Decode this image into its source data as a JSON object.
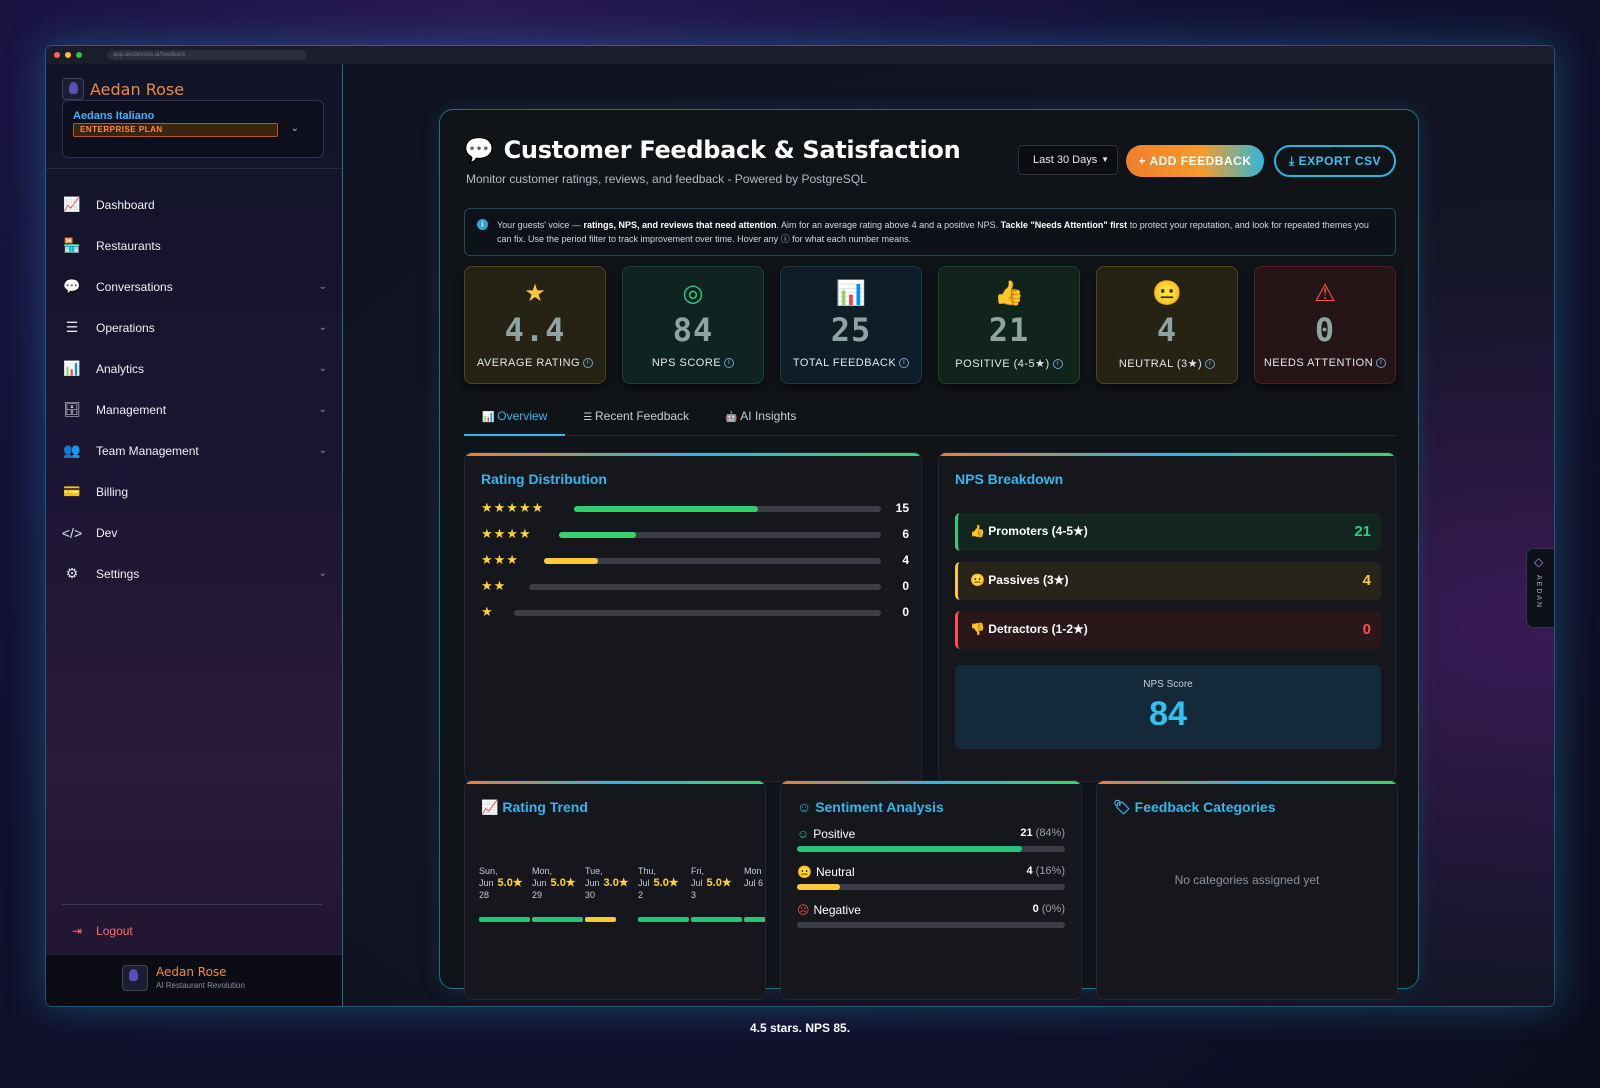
{
  "browser": {
    "url": "app.aedanrose.ai/feedback"
  },
  "sidebar": {
    "brand": "Aedan Rose",
    "org_name": "Aedans Italiano",
    "plan": "ENTERPRISE PLAN",
    "items": [
      {
        "label": "Dashboard",
        "icon": "chart-line-icon",
        "glyph": "📈",
        "chevron": false
      },
      {
        "label": "Restaurants",
        "icon": "store-icon",
        "glyph": "🏪",
        "chevron": false
      },
      {
        "label": "Conversations",
        "icon": "chat-bubbles-icon",
        "glyph": "💬",
        "chevron": true
      },
      {
        "label": "Operations",
        "icon": "task-list-icon",
        "glyph": "☰",
        "chevron": true
      },
      {
        "label": "Analytics",
        "icon": "bar-chart-icon",
        "glyph": "📊",
        "chevron": true
      },
      {
        "label": "Management",
        "icon": "database-icon",
        "glyph": "🗄",
        "chevron": true
      },
      {
        "label": "Team Management",
        "icon": "users-icon",
        "glyph": "👥",
        "chevron": true
      },
      {
        "label": "Billing",
        "icon": "credit-card-icon",
        "glyph": "💳",
        "chevron": false
      },
      {
        "label": "Dev",
        "icon": "code-icon",
        "glyph": "</>",
        "chevron": false
      },
      {
        "label": "Settings",
        "icon": "gear-icon",
        "glyph": "⚙",
        "chevron": true
      }
    ],
    "logout": "Logout",
    "footer_name": "Aedan Rose",
    "footer_sub": "AI Restaurant Revolution"
  },
  "header": {
    "title": "Customer Feedback & Satisfaction",
    "subtitle": "Monitor customer ratings, reviews, and feedback - Powered by PostgreSQL",
    "period": "Last 30 Days",
    "add_button": "+ ADD FEEDBACK",
    "export_button": "EXPORT CSV"
  },
  "info": {
    "part1": "Your guests' voice — ",
    "bold1": "ratings, NPS, and reviews that need attention",
    "part2": ". Aim for an average rating above 4 and a positive NPS. ",
    "bold2": "Tackle \"Needs Attention\" first",
    "part3": " to protect your reputation, and look for repeated themes you can fix. Use the period filter to track improvement over time. Hover any ⓘ for what each number means."
  },
  "stats": [
    {
      "value": "4.4",
      "label": "AVERAGE RATING",
      "icon": "star-icon",
      "glyph": "★",
      "color": "#ffc93a",
      "bg": "#262214"
    },
    {
      "value": "84",
      "label": "NPS SCORE",
      "icon": "target-icon",
      "glyph": "◎",
      "color": "#27d07c",
      "bg": "#0f2420"
    },
    {
      "value": "25",
      "label": "TOTAL FEEDBACK",
      "icon": "bar-chart-icon",
      "glyph": "📊",
      "color": "#2fb8ea",
      "bg": "#0f1e26"
    },
    {
      "value": "21",
      "label": "POSITIVE (4-5★)",
      "icon": "thumbs-up-icon",
      "glyph": "👍",
      "color": "#27d07c",
      "bg": "#10241c"
    },
    {
      "value": "4",
      "label": "NEUTRAL (3★)",
      "icon": "neutral-face-icon",
      "glyph": "😐",
      "color": "#ffc93a",
      "bg": "#262214"
    },
    {
      "value": "0",
      "label": "NEEDS ATTENTION",
      "icon": "warning-icon",
      "glyph": "⚠",
      "color": "#ff4d4d",
      "bg": "#261516"
    }
  ],
  "tabs": [
    {
      "label": "Overview",
      "icon": "chart-icon",
      "active": true
    },
    {
      "label": "Recent Feedback",
      "icon": "list-icon",
      "active": false
    },
    {
      "label": "AI Insights",
      "icon": "robot-icon",
      "active": false
    }
  ],
  "rating_distribution": {
    "title": "Rating Distribution",
    "rows": [
      {
        "stars": "★★★★★",
        "count": "15",
        "fraction": 0.6,
        "color": "#2fd06a"
      },
      {
        "stars": "★★★★",
        "count": "6",
        "fraction": 0.24,
        "color": "#38d26e"
      },
      {
        "stars": "★★★",
        "count": "4",
        "fraction": 0.16,
        "color": "#ffc93a"
      },
      {
        "stars": "★★",
        "count": "0",
        "fraction": 0,
        "color": "#ffc93a"
      },
      {
        "stars": "★",
        "count": "0",
        "fraction": 0,
        "color": "#ff4d4d"
      }
    ]
  },
  "nps": {
    "title": "NPS Breakdown",
    "promoters": {
      "label": "Promoters (4-5★)",
      "value": "21",
      "color": "#27d07c"
    },
    "passives": {
      "label": "Passives (3★)",
      "value": "4",
      "color": "#ffc93a"
    },
    "detractors": {
      "label": "Detractors (1-2★)",
      "value": "0",
      "color": "#ff4d4d"
    },
    "score_label": "NPS Score",
    "score": "84"
  },
  "trend": {
    "title": "Rating Trend",
    "points": [
      {
        "day": "Sun,",
        "date1": "Jun",
        "date2": "28",
        "rating": "5.0★",
        "fraction": 1.0,
        "color": "#27c37a"
      },
      {
        "day": "Mon,",
        "date1": "Jun",
        "date2": "29",
        "rating": "5.0★",
        "fraction": 1.0,
        "color": "#27c37a"
      },
      {
        "day": "Tue,",
        "date1": "Jun",
        "date2": "30",
        "rating": "3.0★",
        "fraction": 0.6,
        "color": "#ffc93a"
      },
      {
        "day": "Thu,",
        "date1": "Jul",
        "date2": "2",
        "rating": "5.0★",
        "fraction": 1.0,
        "color": "#27c37a"
      },
      {
        "day": "Fri,",
        "date1": "Jul",
        "date2": "3",
        "rating": "5.0★",
        "fraction": 1.0,
        "color": "#27c37a"
      },
      {
        "day": "Mon",
        "date1": "Jul 6",
        "date2": "",
        "rating": "",
        "fraction": 1.0,
        "color": "#27c37a"
      }
    ]
  },
  "sentiment": {
    "title": "Sentiment Analysis",
    "rows": [
      {
        "label": "Positive",
        "count": "21",
        "pct": "(84%)",
        "fraction": 0.84,
        "color": "#27c37a",
        "icon": "smile-icon",
        "glyph": "☺",
        "glyph_color": "#27c37a"
      },
      {
        "label": "Neutral",
        "count": "4",
        "pct": "(16%)",
        "fraction": 0.16,
        "color": "#ffc93a",
        "icon": "neutral-face-icon",
        "glyph": "😐",
        "glyph_color": "#ffc93a"
      },
      {
        "label": "Negative",
        "count": "0",
        "pct": "(0%)",
        "fraction": 0,
        "color": "#ff4d4d",
        "icon": "frown-icon",
        "glyph": "☹",
        "glyph_color": "#ff4d4d"
      }
    ]
  },
  "categories": {
    "title": "Feedback Categories",
    "empty": "No categories assigned yet"
  },
  "side_tab": "AEDAN",
  "caption": "4.5 stars. NPS 85."
}
